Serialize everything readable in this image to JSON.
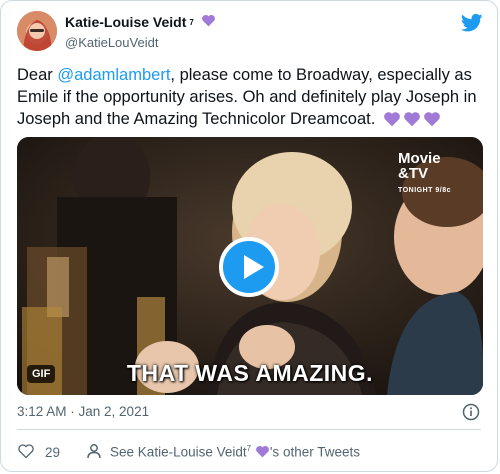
{
  "tweet": {
    "display_name": "Katie-Louise Veidt",
    "name_superscript": "7",
    "handle": "@KatieLouVeidt",
    "text_before": "Dear ",
    "mention": "@adamlambert",
    "text_after": ", please come to Broadway, especially as Emile if the opportunity arises. Oh and definitely play Joseph in Joseph and the Amazing Technicolor Dreamcoat.",
    "timestamp": "3:12 AM · Jan 2, 2021",
    "like_count": "29",
    "see_more_prefix": "See Katie-Louise Veidt",
    "see_more_superscript": "7",
    "see_more_suffix": "'s other Tweets"
  },
  "media": {
    "badge": "GIF",
    "caption": "THAT WAS AMAZING.",
    "mtv_line1": "Movie",
    "mtv_line2": "&TV",
    "mtv_line3": "TONIGHT 9/8c"
  },
  "colors": {
    "accent": "#1d9bf0",
    "heart_purple": "#a07ad6",
    "muted": "#536471"
  },
  "icons": [
    "twitter-bird-icon",
    "purple-heart-icon",
    "play-icon",
    "info-icon",
    "like-heart-icon",
    "user-icon"
  ]
}
